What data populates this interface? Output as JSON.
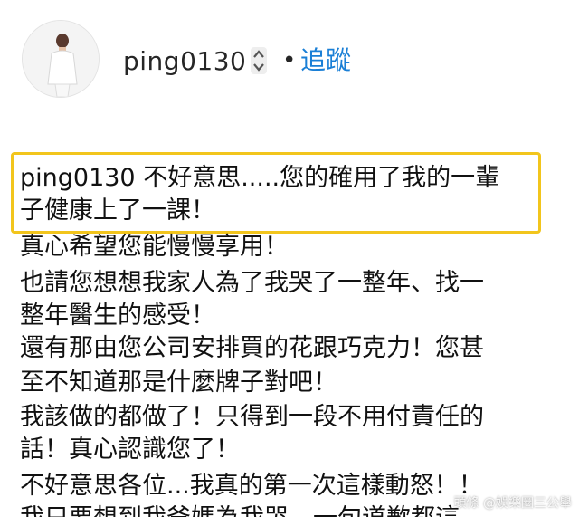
{
  "profile": {
    "username": "ping0130",
    "separator": "•",
    "follow_label": "追蹤"
  },
  "post": {
    "mention": "ping0130",
    "lines": [
      "不好意思.....您的確用了我的一輩",
      "子健康上了一課！",
      "真心希望您能慢慢享用！",
      "也請您想想我家人為了我哭了一整年、找一",
      "整年醫生的感受！",
      "還有那由您公司安排買的花跟巧克力！您甚",
      "至不知道那是什麼牌子對吧！",
      "我該做的都做了！只得到一段不用付責任的",
      "話！真心認識您了！",
      "不好意思各位...我真的第一次這樣動怒！！",
      "我只要想到我爸媽為我哭，一句道歉都這"
    ]
  },
  "watermark": "頭條 @娛樂圈三公舉"
}
